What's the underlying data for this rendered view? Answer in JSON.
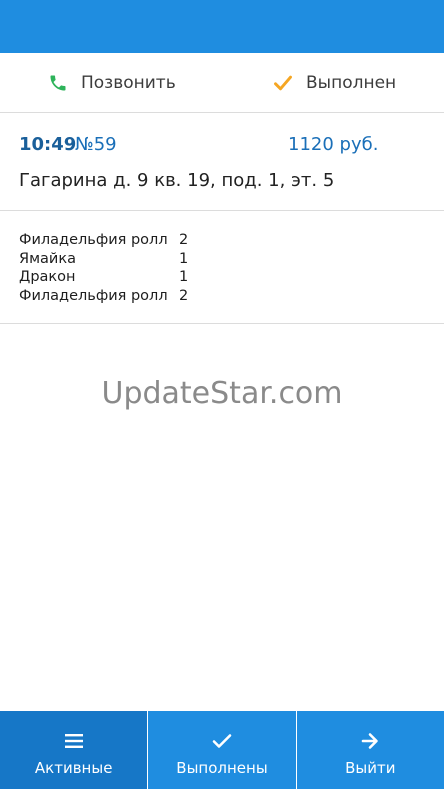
{
  "actions": {
    "call_label": "Позвонить",
    "done_label": "Выполнен"
  },
  "order": {
    "time": "10:49",
    "number": "№59",
    "price": "1120 руб.",
    "address": "Гагарина д. 9 кв. 19, под. 1, эт. 5",
    "items": [
      {
        "name": "Филадельфия ролл",
        "qty": "2"
      },
      {
        "name": "Ямайка",
        "qty": "1"
      },
      {
        "name": "Дракон",
        "qty": "1"
      },
      {
        "name": "Филадельфия ролл",
        "qty": "2"
      }
    ]
  },
  "watermark": "UpdateStar.com",
  "bottom_tabs": [
    {
      "label": "Активные",
      "icon": "menu-icon"
    },
    {
      "label": "Выполнены",
      "icon": "check-icon"
    },
    {
      "label": "Выйти",
      "icon": "arrow-right-icon"
    }
  ],
  "colors": {
    "primary": "#1f8de0",
    "primary_dark": "#1677c7",
    "accent_blue_text": "#1a6fb8",
    "phone_green": "#2db35a",
    "check_orange": "#f5a623"
  }
}
